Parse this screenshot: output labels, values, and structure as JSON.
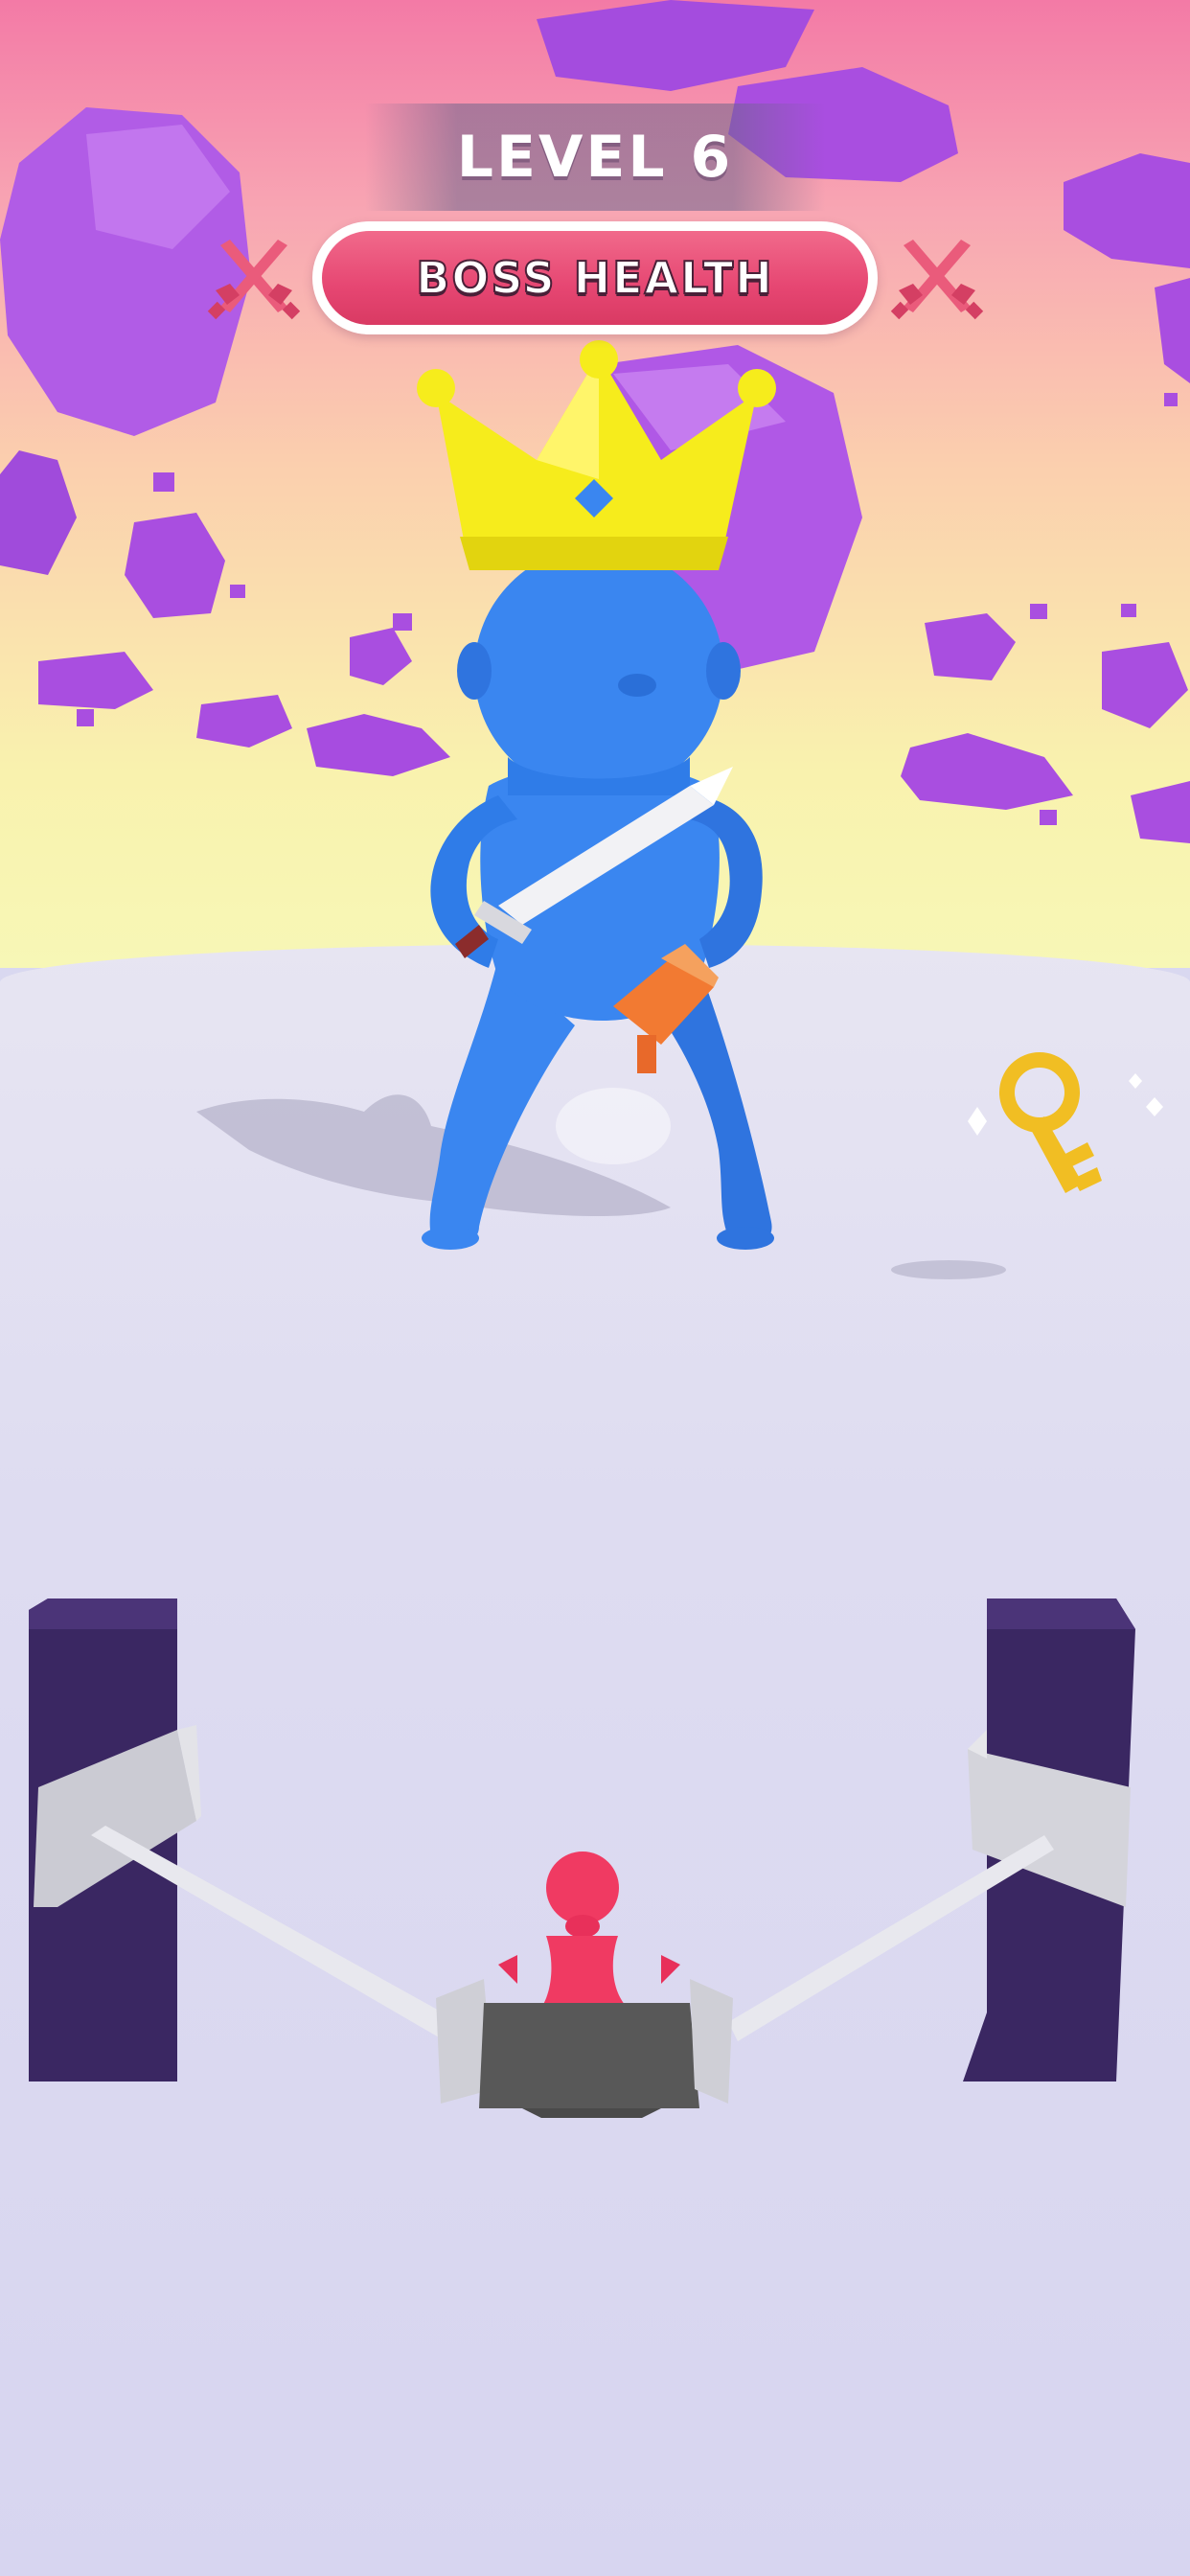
{
  "hud": {
    "level_label": "LEVEL 6",
    "boss_health_label": "BOSS HEALTH",
    "boss_health_fill": 1.0
  },
  "icons": [
    "crossed-swords-icon",
    "key-icon",
    "crown-icon",
    "sword-icon"
  ],
  "colors": {
    "boss_body": "#3a86f0",
    "crown": "#f6ec1c",
    "health_bar": "#e64672",
    "player": "#f03a62",
    "rocks": "#a94ee0",
    "pillars": "#3a2762",
    "key": "#f1be23"
  }
}
